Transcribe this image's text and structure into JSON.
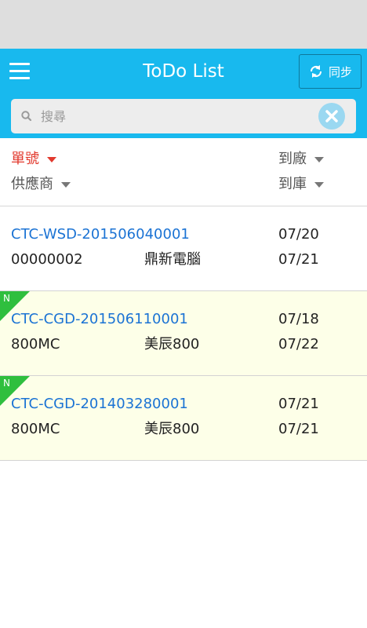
{
  "header": {
    "title": "ToDo List",
    "sync_label": "同步"
  },
  "search": {
    "placeholder": "搜尋"
  },
  "sort": {
    "order_no": "單號",
    "supplier": "供應商",
    "arrive_factory": "到廠",
    "arrive_warehouse": "到庫"
  },
  "colors": {
    "topbar": "#18b9ee",
    "active_sort": "#e23a2e",
    "order_link": "#1b73d4",
    "new_badge": "#2fbf3e",
    "new_row_bg": "#fdffe8"
  },
  "rows": [
    {
      "order_no": "CTC-WSD-201506040001",
      "supplier_code": "00000002",
      "supplier_name": "鼎新電腦",
      "arrive_factory": "07/20",
      "arrive_warehouse": "07/21",
      "badge": ""
    },
    {
      "order_no": "CTC-CGD-201506110001",
      "supplier_code": "800MC",
      "supplier_name": "美辰800",
      "arrive_factory": "07/18",
      "arrive_warehouse": "07/22",
      "badge": "N"
    },
    {
      "order_no": "CTC-CGD-201403280001",
      "supplier_code": "800MC",
      "supplier_name": "美辰800",
      "arrive_factory": "07/21",
      "arrive_warehouse": "07/21",
      "badge": "N"
    }
  ]
}
